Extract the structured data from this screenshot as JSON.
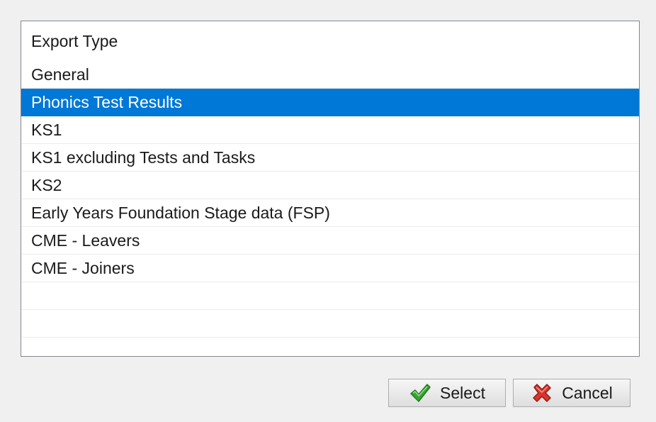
{
  "list": {
    "header": "Export Type",
    "items": [
      {
        "label": "General",
        "selected": false
      },
      {
        "label": "Phonics Test Results",
        "selected": true
      },
      {
        "label": "KS1",
        "selected": false
      },
      {
        "label": "KS1 excluding Tests and Tasks",
        "selected": false
      },
      {
        "label": "KS2",
        "selected": false
      },
      {
        "label": "Early Years Foundation Stage data (FSP)",
        "selected": false
      },
      {
        "label": "CME - Leavers",
        "selected": false
      },
      {
        "label": "CME - Joiners",
        "selected": false
      }
    ],
    "selection_color": "#0078d7"
  },
  "buttons": {
    "select": {
      "label": "Select",
      "icon": "green-checkmark-icon",
      "icon_color": "#3aa335"
    },
    "cancel": {
      "label": "Cancel",
      "icon": "red-cross-icon",
      "icon_color": "#d9342b"
    }
  }
}
